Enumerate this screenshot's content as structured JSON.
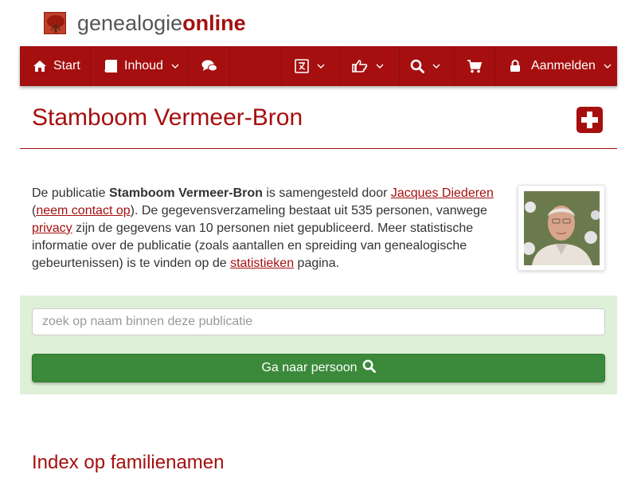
{
  "brand": {
    "name_part1": "genealogie",
    "name_part2": "online"
  },
  "nav": {
    "start_label": "Start",
    "inhoud_label": "Inhoud",
    "login_label": "Aanmelden",
    "bg_color": "#a50f0f"
  },
  "page": {
    "title": "Stamboom Vermeer-Bron"
  },
  "intro": {
    "t1": "De publicatie ",
    "pub_name": "Stamboom Vermeer-Bron",
    "t2": " is samengesteld door ",
    "author_link": "Jacques Diederen",
    "t3": " (",
    "contact_link": "neem contact op",
    "t4": "). De gegevensverzameling bestaat uit 535 personen, vanwege ",
    "privacy_link": "privacy",
    "t5": " zijn de gegevens van 10 personen niet gepubliceerd. Meer statistische informatie over de publicatie (zoals aantallen en spreiding van genealogische gebeurtenissen) is te vinden op de ",
    "stats_link": "statistieken",
    "t6": " pagina."
  },
  "search": {
    "placeholder": "zoek op naam binnen deze publicatie",
    "button_label": "Ga naar persoon"
  },
  "sections": {
    "index_title": "Index op familienamen"
  },
  "icons": {
    "logo": "tree-logo",
    "start": "home-icon",
    "inhoud": "book-icon",
    "chat": "comments-icon",
    "language": "language-icon",
    "share": "thumbs-up-icon",
    "search": "search-icon",
    "cart": "cart-icon",
    "lock": "lock-icon",
    "add": "plus-square-icon"
  },
  "colors": {
    "accent": "#a50f0f",
    "panel": "#dff0d8",
    "button": "#3b8a3b"
  }
}
